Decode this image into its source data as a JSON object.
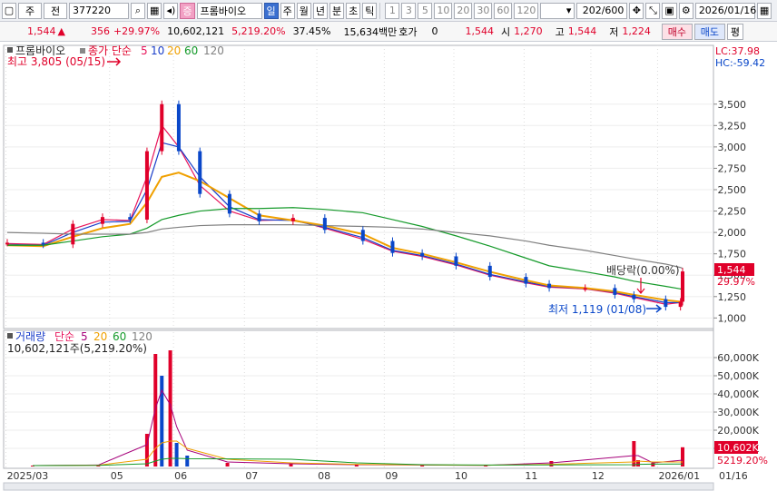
{
  "toolbar": {
    "menu1": "주",
    "menu2": "전",
    "code": "377220",
    "sector_badge": "증",
    "stock_name": "프롬바이오",
    "periods": [
      "일",
      "주",
      "월",
      "년",
      "분",
      "초",
      "틱"
    ],
    "intervals": [
      "1",
      "3",
      "5",
      "10",
      "20",
      "30",
      "60",
      "120"
    ],
    "count": "202/600",
    "date": "2026/01/16"
  },
  "quote": {
    "price": "1,544",
    "change": "356",
    "change_rate": "+29.97%",
    "volume": "10,602,121",
    "volume_rate": "5,219.20%",
    "turnover": "37.45%",
    "amount": "15,634백만",
    "hoga_label": "호가",
    "hoga_value": "0",
    "hoga_price": "1,544",
    "open_label": "시",
    "open_value": "1,270",
    "high_label": "고",
    "high_value": "1,544",
    "low_label": "저",
    "low_value": "1,224",
    "buy_label": "매수",
    "sell_label": "매도",
    "eval_label": "평"
  },
  "price_panel": {
    "legend_name": "프롬바이오",
    "legend_item": "종가 단순",
    "ma_periods": [
      "5",
      "10",
      "20",
      "60",
      "120"
    ],
    "ma_colors": [
      "#e8145a",
      "#1a3ec9",
      "#f0a000",
      "#159a2a",
      "#808080"
    ],
    "lc": "LC:37.98",
    "hc": "HC:-59.42",
    "annot_high": "최고 3,805 (05/15)",
    "annot_low": "최저 1,119 (01/08)",
    "annot_ex": "배당락(0.00%)",
    "current_price": "1,544",
    "current_pct": "29.97%",
    "y_ticks": [
      "3,500",
      "3,250",
      "3,000",
      "2,750",
      "2,500",
      "2,250",
      "2,000",
      "1,750",
      "1,500",
      "1,250",
      "1,000"
    ]
  },
  "volume_panel": {
    "legend_name": "거래량",
    "legend_item": "단순",
    "ma_periods": [
      "5",
      "20",
      "60",
      "120"
    ],
    "info": "10,602,121주(5,219.20%)",
    "current_volume": "10,602K",
    "current_pct": "5219.20%",
    "y_ticks": [
      "60,000K",
      "50,000K",
      "40,000K",
      "30,000K",
      "20,000K",
      "10,000K"
    ]
  },
  "x_axis": {
    "labels": [
      "2025/03",
      "05",
      "06",
      "07",
      "08",
      "09",
      "10",
      "11",
      "12",
      "2026/01"
    ],
    "right_label": "01/16"
  },
  "chart_data": [
    {
      "type": "line",
      "title": "프롬바이오",
      "ylim": [
        940,
        3890
      ],
      "series": [
        {
          "name": "종가",
          "x": [
            "2025/03/03",
            "2025/03/20",
            "2025/04/03",
            "2025/04/17",
            "2025/04/30",
            "2025/05/08",
            "2025/05/15",
            "2025/05/23",
            "2025/06/02",
            "2025/06/16",
            "2025/06/30",
            "2025/07/16",
            "2025/07/31",
            "2025/08/18",
            "2025/09/01",
            "2025/09/15",
            "2025/10/01",
            "2025/10/17",
            "2025/11/03",
            "2025/11/14",
            "2025/12/01",
            "2025/12/15",
            "2025/12/24",
            "2026/01/08",
            "2026/01/15",
            "2026/01/16"
          ],
          "values": [
            1880,
            1860,
            2100,
            2180,
            2150,
            2950,
            3500,
            2950,
            2450,
            2220,
            2130,
            2170,
            2030,
            1900,
            1760,
            1720,
            1610,
            1480,
            1400,
            1350,
            1350,
            1270,
            1220,
            1130,
            1190,
            1544
          ]
        },
        {
          "name": "5",
          "values": [
            1870,
            1860,
            2040,
            2150,
            2140,
            2650,
            3250,
            3000,
            2550,
            2250,
            2140,
            2150,
            2050,
            1920,
            1780,
            1720,
            1620,
            1500,
            1410,
            1360,
            1340,
            1290,
            1240,
            1160,
            1180,
            1250
          ]
        },
        {
          "name": "10",
          "values": [
            1860,
            1850,
            2000,
            2120,
            2130,
            2500,
            3050,
            3000,
            2650,
            2300,
            2150,
            2140,
            2060,
            1940,
            1790,
            1730,
            1630,
            1510,
            1420,
            1370,
            1345,
            1300,
            1250,
            1180,
            1180,
            1220
          ]
        },
        {
          "name": "20",
          "values": [
            1850,
            1840,
            1950,
            2050,
            2100,
            2350,
            2650,
            2700,
            2600,
            2400,
            2200,
            2140,
            2080,
            1980,
            1820,
            1750,
            1650,
            1540,
            1440,
            1380,
            1350,
            1310,
            1270,
            1210,
            1190,
            1210
          ]
        },
        {
          "name": "60",
          "values": [
            1850,
            1850,
            1900,
            1950,
            1980,
            2050,
            2150,
            2200,
            2250,
            2280,
            2280,
            2290,
            2270,
            2230,
            2150,
            2070,
            1960,
            1840,
            1700,
            1610,
            1540,
            1480,
            1430,
            1370,
            1340,
            1330
          ]
        },
        {
          "name": "120",
          "values": [
            2000,
            1990,
            1980,
            1980,
            1980,
            2000,
            2040,
            2060,
            2080,
            2090,
            2090,
            2090,
            2080,
            2070,
            2060,
            2040,
            2000,
            1960,
            1900,
            1850,
            1790,
            1730,
            1690,
            1630,
            1590,
            1580
          ]
        }
      ]
    },
    {
      "type": "bar",
      "title": "거래량",
      "ylim": [
        0,
        65000
      ],
      "x": [
        "2025/03",
        "2025/04",
        "2025/05/08",
        "2025/05/12",
        "2025/05/15",
        "2025/05/19",
        "2025/05/22",
        "2025/05/27",
        "2025/06",
        "2025/07",
        "2025/08",
        "2025/09",
        "2025/10",
        "2025/11",
        "2025/12/24",
        "2025/12/26",
        "2026/01/02",
        "2026/01/16"
      ],
      "values": [
        500,
        1000,
        18000,
        62000,
        50000,
        64000,
        13000,
        6000,
        2000,
        1500,
        1000,
        800,
        600,
        3000,
        14000,
        3500,
        2000,
        10602
      ],
      "series": [
        {
          "name": "5",
          "values": [
            500,
            800,
            12000,
            32000,
            42000,
            34000,
            22000,
            9000,
            2500,
            1500,
            1000,
            800,
            600,
            2000,
            6000,
            6000,
            2000,
            3500
          ]
        },
        {
          "name": "20",
          "values": [
            500,
            700,
            4000,
            10000,
            13000,
            14000,
            14000,
            10000,
            4000,
            2000,
            1200,
            900,
            700,
            1200,
            2500,
            3000,
            2500,
            2500
          ]
        },
        {
          "name": "60",
          "values": [
            500,
            600,
            1500,
            3000,
            4000,
            4500,
            4500,
            4300,
            4200,
            4000,
            2000,
            1000,
            800,
            900,
            1000,
            1200,
            1300,
            1400
          ]
        }
      ]
    }
  ]
}
